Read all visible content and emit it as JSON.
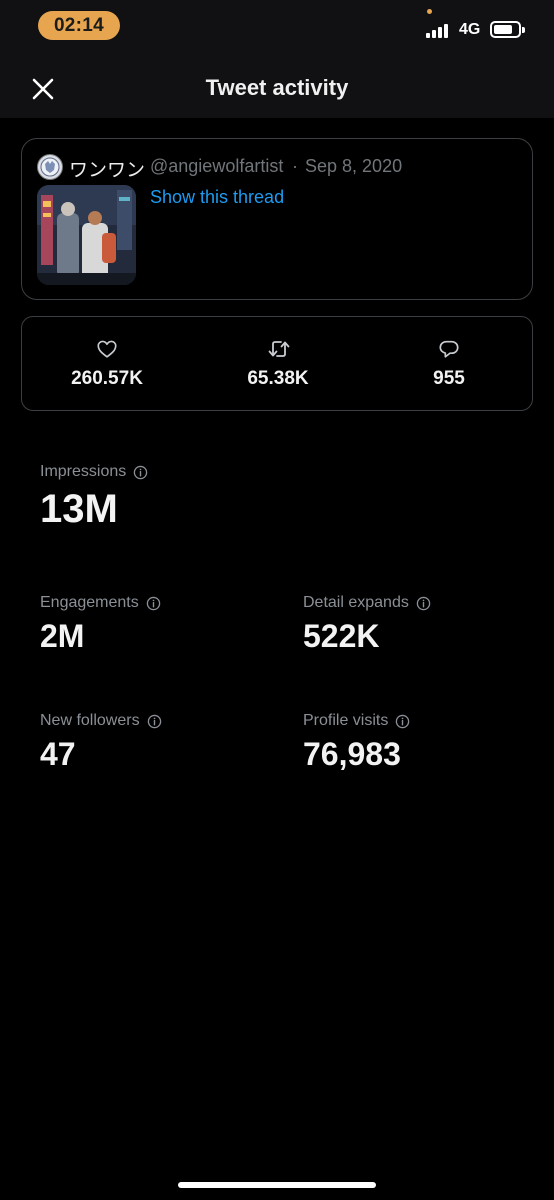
{
  "status_bar": {
    "time": "02:14",
    "network": "4G"
  },
  "header": {
    "title": "Tweet activity",
    "close_icon": "close-icon"
  },
  "tweet": {
    "name": "ワンワン",
    "handle": "@angiewolfartist",
    "separator": "·",
    "date": "Sep 8, 2020",
    "thread_link": "Show this thread"
  },
  "stats": {
    "likes": {
      "icon": "heart-icon",
      "value": "260.57K"
    },
    "retweets": {
      "icon": "retweet-icon",
      "value": "65.38K"
    },
    "replies": {
      "icon": "reply-icon",
      "value": "955"
    }
  },
  "metrics": {
    "impressions": {
      "label": "Impressions",
      "value": "13M"
    },
    "engagements": {
      "label": "Engagements",
      "value": "2M"
    },
    "detail_expands": {
      "label": "Detail expands",
      "value": "522K"
    },
    "new_followers": {
      "label": "New followers",
      "value": "47"
    },
    "profile_visits": {
      "label": "Profile visits",
      "value": "76,983"
    }
  },
  "colors": {
    "background": "#000000",
    "header": "#111113",
    "accent_link": "#1d9bf0",
    "time_pill": "#e7a550",
    "muted_text": "#71767b"
  }
}
